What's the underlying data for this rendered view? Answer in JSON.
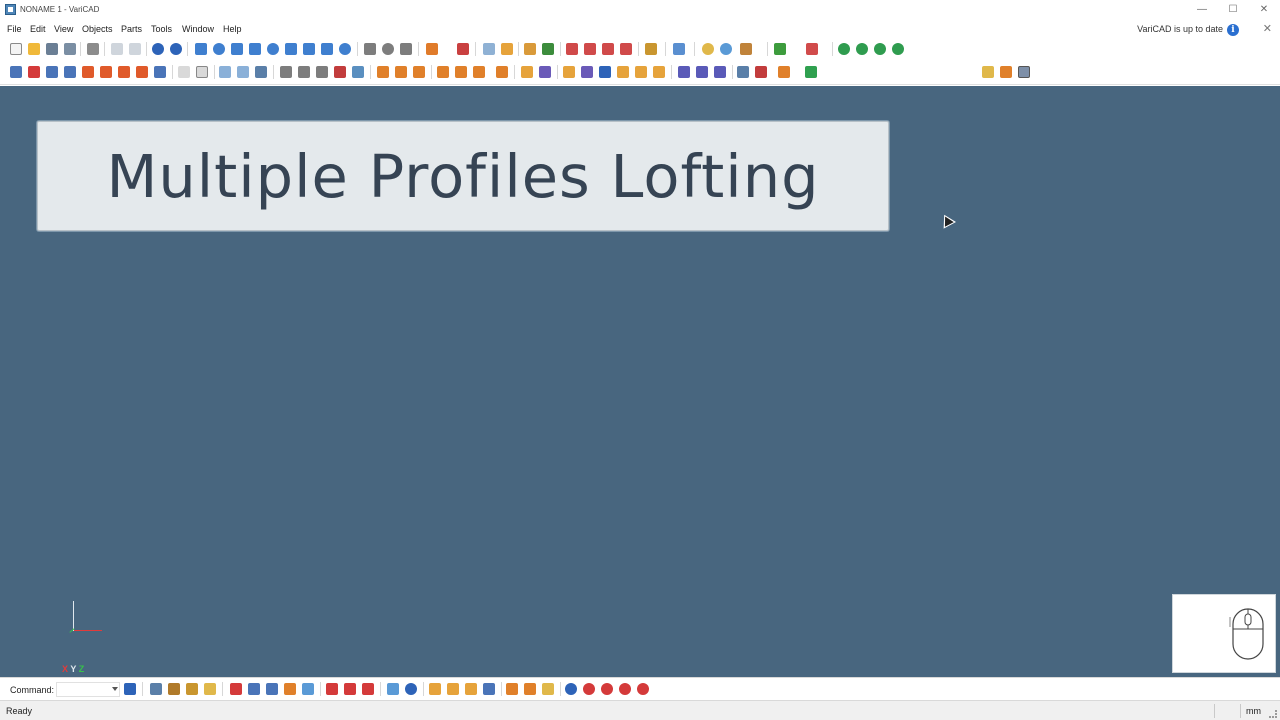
{
  "window": {
    "title": "NONAME 1 - VariCAD",
    "minimize_glyph": "—",
    "maximize_glyph": "☐",
    "close_glyph": "✕"
  },
  "menu": {
    "items": [
      "File",
      "Edit",
      "View",
      "Objects",
      "Parts",
      "Tools",
      "Window",
      "Help"
    ],
    "update_notice": "VariCAD is up to date",
    "info_glyph": "i",
    "close_glyph": "✕"
  },
  "viewport": {
    "title_card_text": "Multiple Profiles Lofting",
    "background_color": "#48667f"
  },
  "axis": {
    "x": "X",
    "y": "Y",
    "z": "Z"
  },
  "command": {
    "label": "Command:",
    "value": ""
  },
  "status": {
    "text": "Ready",
    "units": "mm"
  },
  "colors": {
    "accent_blue": "#2a6fd0",
    "axis_x": "#e23b3b",
    "axis_y": "#e0e8ee",
    "axis_z": "#36c24a"
  }
}
